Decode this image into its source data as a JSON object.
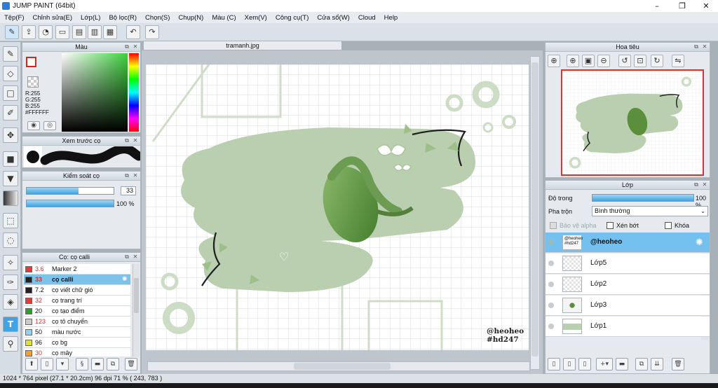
{
  "window": {
    "title": "JUMP PAINT (64bit)"
  },
  "menu": [
    "Tệp(F)",
    "Chỉnh sửa(E)",
    "Lớp(L)",
    "Bộ lọc(R)",
    "Chọn(S)",
    "Chụp(N)",
    "Màu (C)",
    "Xem(V)",
    "Công cụ(T)",
    "Cửa sổ(W)",
    "Cloud",
    "Help"
  ],
  "color_panel": {
    "title": "Màu",
    "r": "R:255",
    "g": "G:255",
    "b": "B:255",
    "hex": "#FFFFFF"
  },
  "brush_preview": {
    "title": "Xem trước cọ"
  },
  "brush_control": {
    "title": "Kiểm soát cọ",
    "size": "33",
    "opacity": "100 %",
    "size_fraction": 0.6,
    "opacity_fraction": 1.0
  },
  "brush_list": {
    "title": "Cọ: cọ calli",
    "items": [
      {
        "size": "3.6",
        "name": "Marker 2",
        "color": "#e23b3b"
      },
      {
        "size": "33",
        "name": "cọ calli",
        "color": "#222222"
      },
      {
        "size": "7.2",
        "name": "cọ viết chữ gió",
        "color": "#222222"
      },
      {
        "size": "32",
        "name": "cọ trang trí",
        "color": "#e23b3b"
      },
      {
        "size": "20",
        "name": "cọ tạo điểm",
        "color": "#2aa02a"
      },
      {
        "size": "123",
        "name": "cọ tô chuyển",
        "color": "#cccccc"
      },
      {
        "size": "50",
        "name": "màu nước",
        "color": "#8fd3f4"
      },
      {
        "size": "96",
        "name": "cọ bg",
        "color": "#dddd44"
      },
      {
        "size": "30",
        "name": "cọ mây",
        "color": "#f0a030"
      }
    ]
  },
  "document": {
    "tab": "tramanh.jpg",
    "signature_line1": "@heoheo",
    "signature_line2": "#hd247"
  },
  "navigator": {
    "title": "Hoa tiêu"
  },
  "layers_panel": {
    "title": "Lớp",
    "opacity_label": "Độ trong",
    "opacity_value": "100 %",
    "opacity_fraction": 1.0,
    "blend_label": "Pha trộn",
    "blend_value": "Bình thường",
    "protect_alpha": "Bảo vệ alpha",
    "clipping": "Xén bớt",
    "lock": "Khóa",
    "layers": [
      {
        "name": "@heoheo",
        "selected": true
      },
      {
        "name": "Lớp5",
        "selected": false
      },
      {
        "name": "Lớp2",
        "selected": false
      },
      {
        "name": "Lớp3",
        "selected": false
      },
      {
        "name": "Lớp1",
        "selected": false
      }
    ]
  },
  "status": {
    "text": "1024 * 764 pixel   (27.1 * 20.2cm)   96 dpi   71 %   ( 243, 783 )"
  },
  "colors": {
    "accent": "#3fa4e2",
    "selection": "#7cc3ec",
    "canvas_green": "#b9cfb0",
    "dark_green": "#5b8f3c"
  }
}
